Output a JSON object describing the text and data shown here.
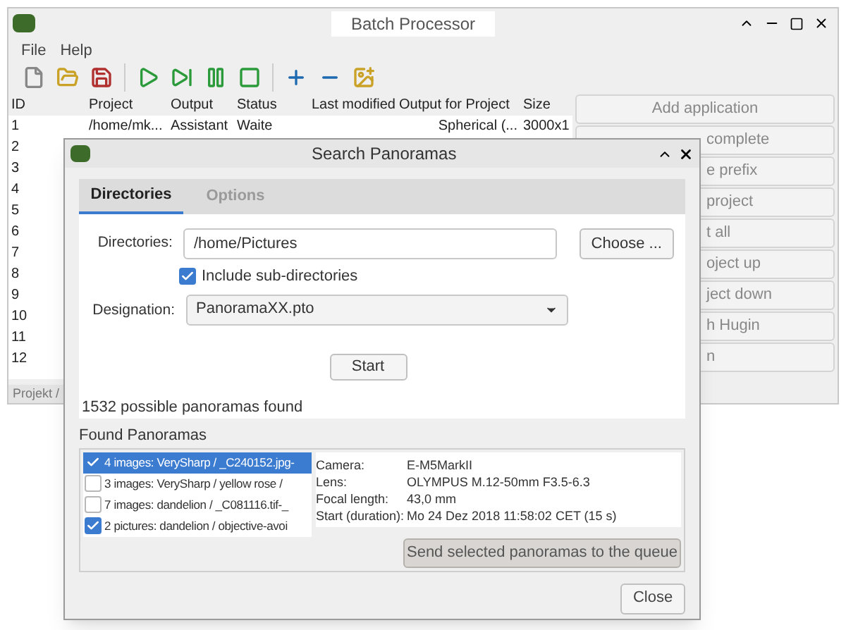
{
  "window": {
    "title": "Batch Processor"
  },
  "menu": [
    "File",
    "Help"
  ],
  "table": {
    "columns": [
      "ID",
      "Project",
      "Output",
      "Status",
      "Last modified",
      "Output for Project",
      "Size"
    ],
    "rows": [
      {
        "cells": [
          "1",
          "/home/mk...",
          "Assistant",
          "Waite",
          "",
          "Spherical (...",
          "3000x1"
        ]
      },
      {
        "cells": [
          "2"
        ]
      },
      {
        "cells": [
          "3"
        ]
      },
      {
        "cells": [
          "4"
        ]
      },
      {
        "cells": [
          "5"
        ]
      },
      {
        "cells": [
          "6"
        ]
      },
      {
        "cells": [
          "7"
        ]
      },
      {
        "cells": [
          "8"
        ]
      },
      {
        "cells": [
          "9"
        ]
      },
      {
        "cells": [
          "10"
        ]
      },
      {
        "cells": [
          "11"
        ]
      },
      {
        "cells": [
          "12"
        ]
      }
    ]
  },
  "side_buttons": [
    {
      "label": "Add application",
      "covered": false
    },
    {
      "label": "complete",
      "covered": true
    },
    {
      "label": "e prefix",
      "covered": true
    },
    {
      "label": "project",
      "covered": true
    },
    {
      "label": "t all",
      "covered": true
    },
    {
      "label": "oject up",
      "covered": true
    },
    {
      "label": "ject down",
      "covered": true
    },
    {
      "label": "h Hugin",
      "covered": true
    },
    {
      "label": "n",
      "covered": true
    }
  ],
  "status_tab": "Projekt /",
  "dialog": {
    "title": "Search Panoramas",
    "tabs": [
      {
        "label": "Directories",
        "selected": true
      },
      {
        "label": "Options",
        "selected": false
      }
    ],
    "directories_label": "Directories:",
    "directories_value": "/home/Pictures",
    "choose_button": "Choose ...",
    "include_sub": {
      "label": "Include sub-directories",
      "checked": true
    },
    "designation_label": "Designation:",
    "designation_value": "PanoramaXX.pto",
    "start_button": "Start",
    "result": "1532 possible panoramas found",
    "found_title": "Found Panoramas",
    "panoramas": [
      {
        "label": "4 images: VerySharp / _C240152.jpg-",
        "checked": true,
        "selected": true
      },
      {
        "label": "3 images: VerySharp / yellow rose /",
        "checked": false,
        "selected": false
      },
      {
        "label": "7 images: dandelion / _C081116.tif-_",
        "checked": false,
        "selected": false
      },
      {
        "label": "2 pictures: dandelion / objective-avoi",
        "checked": true,
        "selected": false
      }
    ],
    "details": [
      {
        "label": "Camera:",
        "value": "E-M5MarkII"
      },
      {
        "label": "Lens:",
        "value": "OLYMPUS M.12-50mm F3.5-6.3"
      },
      {
        "label": "Focal length:",
        "value": "43,0 mm"
      },
      {
        "label": "Start (duration):",
        "value": "Mo 24 Dez 2018 11:58:02 CET (15 s)"
      }
    ],
    "send_button": "Send selected panoramas to the queue",
    "close_button": "Close"
  }
}
